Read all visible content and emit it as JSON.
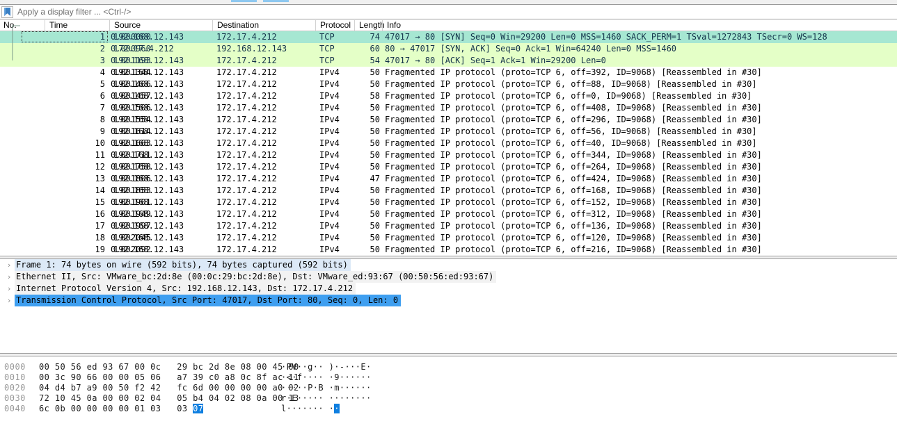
{
  "app": {
    "name": "Wireshark"
  },
  "toolbar": {
    "chip_color": "#8ec8f0",
    "chips": 2
  },
  "filter": {
    "icon": "filter-bookmark-icon",
    "value": "",
    "placeholder": "Apply a display filter ... <Ctrl-/>"
  },
  "packet_list": {
    "columns": [
      {
        "key": "no",
        "label": "No."
      },
      {
        "key": "time",
        "label": "Time"
      },
      {
        "key": "src",
        "label": "Source"
      },
      {
        "key": "dst",
        "label": "Destination"
      },
      {
        "key": "proto",
        "label": "Protocol"
      },
      {
        "key": "len",
        "label": "Length"
      },
      {
        "key": "info",
        "label": "Info"
      }
    ],
    "colors": {
      "tcp_syn": "#a6e7d2",
      "tcp_other": "#e4ffc7",
      "plain": "#ffffff",
      "text": "#13334a"
    },
    "selected_row": 1,
    "rows": [
      {
        "no": "1",
        "time": "0.000000",
        "src": "192.168.12.143",
        "dst": "172.17.4.212",
        "proto": "TCP",
        "len": "74",
        "info": "47017 → 80 [SYN] Seq=0 Win=29200 Len=0 MSS=1460 SACK_PERM=1 TSval=1272843 TSecr=0 WS=128",
        "style": "row-tcp"
      },
      {
        "no": "2",
        "time": "0.000960",
        "src": "172.17.4.212",
        "dst": "192.168.12.143",
        "proto": "TCP",
        "len": "60",
        "info": "80 → 47017 [SYN, ACK] Seq=0 Ack=1 Win=64240 Len=0 MSS=1460",
        "style": "row-tcp2"
      },
      {
        "no": "3",
        "time": "0.001193",
        "src": "192.168.12.143",
        "dst": "172.17.4.212",
        "proto": "TCP",
        "len": "54",
        "info": "47017 → 80 [ACK] Seq=1 Ack=1 Win=29200 Len=0",
        "style": "row-tcp2"
      },
      {
        "no": "4",
        "time": "0.001344",
        "src": "192.168.12.143",
        "dst": "172.17.4.212",
        "proto": "IPv4",
        "len": "50",
        "info": "Fragmented IP protocol (proto=TCP 6, off=392, ID=9068) [Reassembled in #30]",
        "style": "row-plain"
      },
      {
        "no": "5",
        "time": "0.001406",
        "src": "192.168.12.143",
        "dst": "172.17.4.212",
        "proto": "IPv4",
        "len": "50",
        "info": "Fragmented IP protocol (proto=TCP 6, off=88, ID=9068) [Reassembled in #30]",
        "style": "row-plain"
      },
      {
        "no": "6",
        "time": "0.001457",
        "src": "192.168.12.143",
        "dst": "172.17.4.212",
        "proto": "IPv4",
        "len": "58",
        "info": "Fragmented IP protocol (proto=TCP 6, off=0, ID=9068) [Reassembled in #30]",
        "style": "row-plain"
      },
      {
        "no": "7",
        "time": "0.001506",
        "src": "192.168.12.143",
        "dst": "172.17.4.212",
        "proto": "IPv4",
        "len": "50",
        "info": "Fragmented IP protocol (proto=TCP 6, off=408, ID=9068) [Reassembled in #30]",
        "style": "row-plain"
      },
      {
        "no": "8",
        "time": "0.001554",
        "src": "192.168.12.143",
        "dst": "172.17.4.212",
        "proto": "IPv4",
        "len": "50",
        "info": "Fragmented IP protocol (proto=TCP 6, off=296, ID=9068) [Reassembled in #30]",
        "style": "row-plain"
      },
      {
        "no": "9",
        "time": "0.001614",
        "src": "192.168.12.143",
        "dst": "172.17.4.212",
        "proto": "IPv4",
        "len": "50",
        "info": "Fragmented IP protocol (proto=TCP 6, off=56, ID=9068) [Reassembled in #30]",
        "style": "row-plain"
      },
      {
        "no": "10",
        "time": "0.001663",
        "src": "192.168.12.143",
        "dst": "172.17.4.212",
        "proto": "IPv4",
        "len": "50",
        "info": "Fragmented IP protocol (proto=TCP 6, off=40, ID=9068) [Reassembled in #30]",
        "style": "row-plain"
      },
      {
        "no": "11",
        "time": "0.001711",
        "src": "192.168.12.143",
        "dst": "172.17.4.212",
        "proto": "IPv4",
        "len": "50",
        "info": "Fragmented IP protocol (proto=TCP 6, off=344, ID=9068) [Reassembled in #30]",
        "style": "row-plain"
      },
      {
        "no": "12",
        "time": "0.001758",
        "src": "192.168.12.143",
        "dst": "172.17.4.212",
        "proto": "IPv4",
        "len": "50",
        "info": "Fragmented IP protocol (proto=TCP 6, off=264, ID=9068) [Reassembled in #30]",
        "style": "row-plain"
      },
      {
        "no": "13",
        "time": "0.001806",
        "src": "192.168.12.143",
        "dst": "172.17.4.212",
        "proto": "IPv4",
        "len": "47",
        "info": "Fragmented IP protocol (proto=TCP 6, off=424, ID=9068) [Reassembled in #30]",
        "style": "row-plain"
      },
      {
        "no": "14",
        "time": "0.001853",
        "src": "192.168.12.143",
        "dst": "172.17.4.212",
        "proto": "IPv4",
        "len": "50",
        "info": "Fragmented IP protocol (proto=TCP 6, off=168, ID=9068) [Reassembled in #30]",
        "style": "row-plain"
      },
      {
        "no": "15",
        "time": "0.001901",
        "src": "192.168.12.143",
        "dst": "172.17.4.212",
        "proto": "IPv4",
        "len": "50",
        "info": "Fragmented IP protocol (proto=TCP 6, off=152, ID=9068) [Reassembled in #30]",
        "style": "row-plain"
      },
      {
        "no": "16",
        "time": "0.001949",
        "src": "192.168.12.143",
        "dst": "172.17.4.212",
        "proto": "IPv4",
        "len": "50",
        "info": "Fragmented IP protocol (proto=TCP 6, off=312, ID=9068) [Reassembled in #30]",
        "style": "row-plain"
      },
      {
        "no": "17",
        "time": "0.001997",
        "src": "192.168.12.143",
        "dst": "172.17.4.212",
        "proto": "IPv4",
        "len": "50",
        "info": "Fragmented IP protocol (proto=TCP 6, off=136, ID=9068) [Reassembled in #30]",
        "style": "row-plain"
      },
      {
        "no": "18",
        "time": "0.002045",
        "src": "192.168.12.143",
        "dst": "172.17.4.212",
        "proto": "IPv4",
        "len": "50",
        "info": "Fragmented IP protocol (proto=TCP 6, off=120, ID=9068) [Reassembled in #30]",
        "style": "row-plain"
      },
      {
        "no": "19",
        "time": "0.002092",
        "src": "192.168.12.143",
        "dst": "172.17.4.212",
        "proto": "IPv4",
        "len": "50",
        "info": "Fragmented IP protocol (proto=TCP 6, off=216, ID=9068) [Reassembled in #30]",
        "style": "row-plain"
      }
    ]
  },
  "detail_pane": {
    "expander": "›",
    "nodes": [
      {
        "text": "Frame 1: 74 bytes on wire (592 bits), 74 bytes captured (592 bits)",
        "style": "sel-light"
      },
      {
        "text": "Ethernet II, Src: VMware_bc:2d:8e (00:0c:29:bc:2d:8e), Dst: VMware_ed:93:67 (00:50:56:ed:93:67)",
        "style": "sel-grey"
      },
      {
        "text": "Internet Protocol Version 4, Src: 192.168.12.143, Dst: 172.17.4.212",
        "style": "sel-grey"
      },
      {
        "text": "Transmission Control Protocol, Src Port: 47017, Dst Port: 80, Seq: 0, Len: 0",
        "style": "sel-blue"
      }
    ],
    "selected_node": 3,
    "selection_color": "#3f9ff0"
  },
  "hex_pane": {
    "highlight_color": "#0f7fe0",
    "rows": [
      {
        "offset": "0000",
        "hex": "00 50 56 ed 93 67 00 0c   29 bc 2d 8e 08 00 45 00",
        "ascii": "·PV··g·· )·-···E·"
      },
      {
        "offset": "0010",
        "hex": "00 3c 90 66 00 00 05 06   a7 39 c0 a8 0c 8f ac 11",
        "ascii": "·<·f···· ·9······"
      },
      {
        "offset": "0020",
        "hex": "04 d4 b7 a9 00 50 f2 42   fc 6d 00 00 00 00 a0 02",
        "ascii": "·····P·B ·m······"
      },
      {
        "offset": "0030",
        "hex": "72 10 45 0a 00 00 02 04   05 b4 04 02 08 0a 00 13",
        "ascii": "r·E····· ········"
      },
      {
        "offset": "0040",
        "hex_pre": "6c 0b 00 00 00 00 01 03   03 ",
        "hex_hl": "07",
        "ascii_pre": "l······· ·",
        "ascii_hl": "·"
      }
    ],
    "selected_byte": "07",
    "selected_offset": "0040"
  }
}
